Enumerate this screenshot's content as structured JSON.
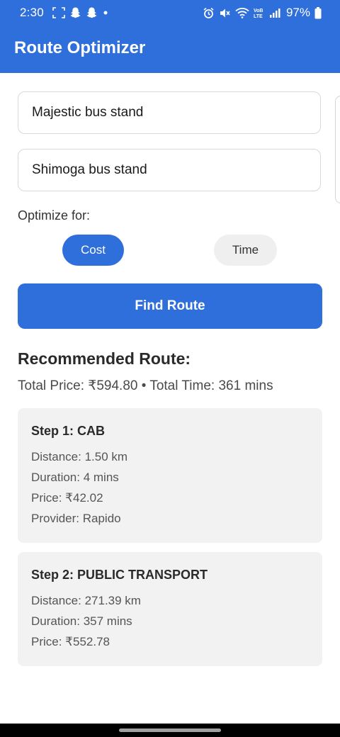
{
  "status_bar": {
    "time": "2:30",
    "battery_percent": "97%",
    "left_icons": [
      "screenshot-icon",
      "snapchat-icon",
      "snapchat-icon",
      "dot-icon"
    ],
    "right_icons": [
      "alarm-icon",
      "mute-icon",
      "wifi-icon",
      "volte-icon",
      "signal-icon",
      "battery-icon"
    ]
  },
  "app_bar": {
    "title": "Route Optimizer",
    "color": "#2f6fdc"
  },
  "form": {
    "origin_value": "Majestic bus stand",
    "destination_value": "Shimoga bus stand",
    "optimize_label": "Optimize for:",
    "options": [
      {
        "label": "Cost",
        "selected": true
      },
      {
        "label": "Time",
        "selected": false
      }
    ],
    "find_button_label": "Find Route"
  },
  "result": {
    "heading": "Recommended Route:",
    "summary": "Total Price: ₹594.80 • Total Time: 361 mins",
    "steps": [
      {
        "title": "Step 1: CAB",
        "lines": [
          "Distance: 1.50 km",
          "Duration: 4 mins",
          "Price: ₹42.02",
          "Provider: Rapido"
        ]
      },
      {
        "title": "Step 2: PUBLIC TRANSPORT",
        "lines": [
          "Distance: 271.39 km",
          "Duration: 357 mins",
          "Price: ₹552.78"
        ]
      }
    ]
  }
}
